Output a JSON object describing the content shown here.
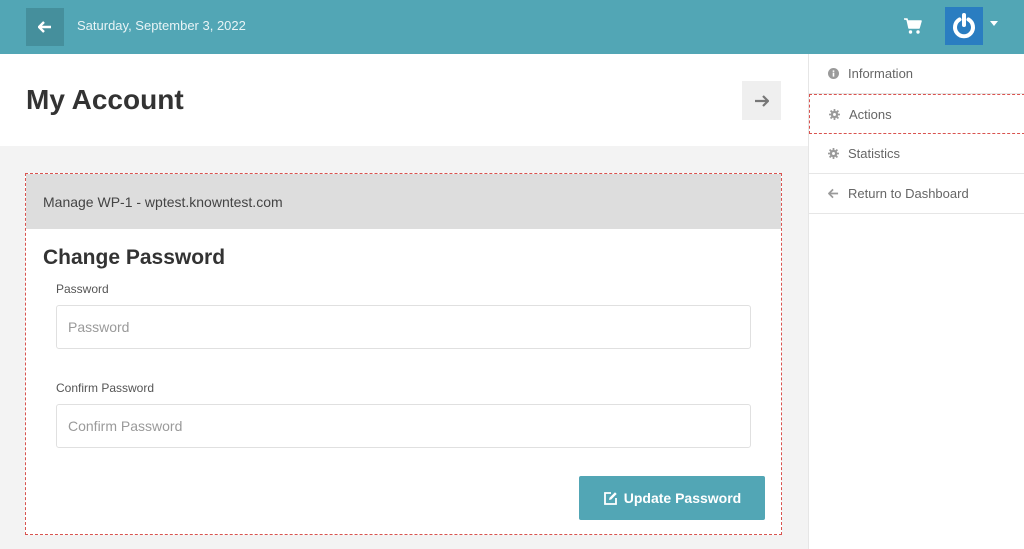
{
  "header": {
    "date": "Saturday, September 3, 2022"
  },
  "page": {
    "title": "My Account"
  },
  "card": {
    "header": "Manage WP-1 - wptest.knowntest.com",
    "section_title": "Change Password",
    "password": {
      "label": "Password",
      "placeholder": "Password",
      "value": ""
    },
    "confirm": {
      "label": "Confirm Password",
      "placeholder": "Confirm Password",
      "value": ""
    },
    "submit_label": "Update Password"
  },
  "sidebar": {
    "items": [
      {
        "label": "Information",
        "icon": "info-icon"
      },
      {
        "label": "Actions",
        "icon": "gear-icon",
        "active": true
      },
      {
        "label": "Statistics",
        "icon": "gear-icon"
      },
      {
        "label": "Return to Dashboard",
        "icon": "arrow-left-icon"
      }
    ]
  },
  "colors": {
    "brand": "#52a6b5",
    "brand_dark": "#458f9c",
    "avatar": "#2a7dc1",
    "highlight": "#d9534f"
  }
}
